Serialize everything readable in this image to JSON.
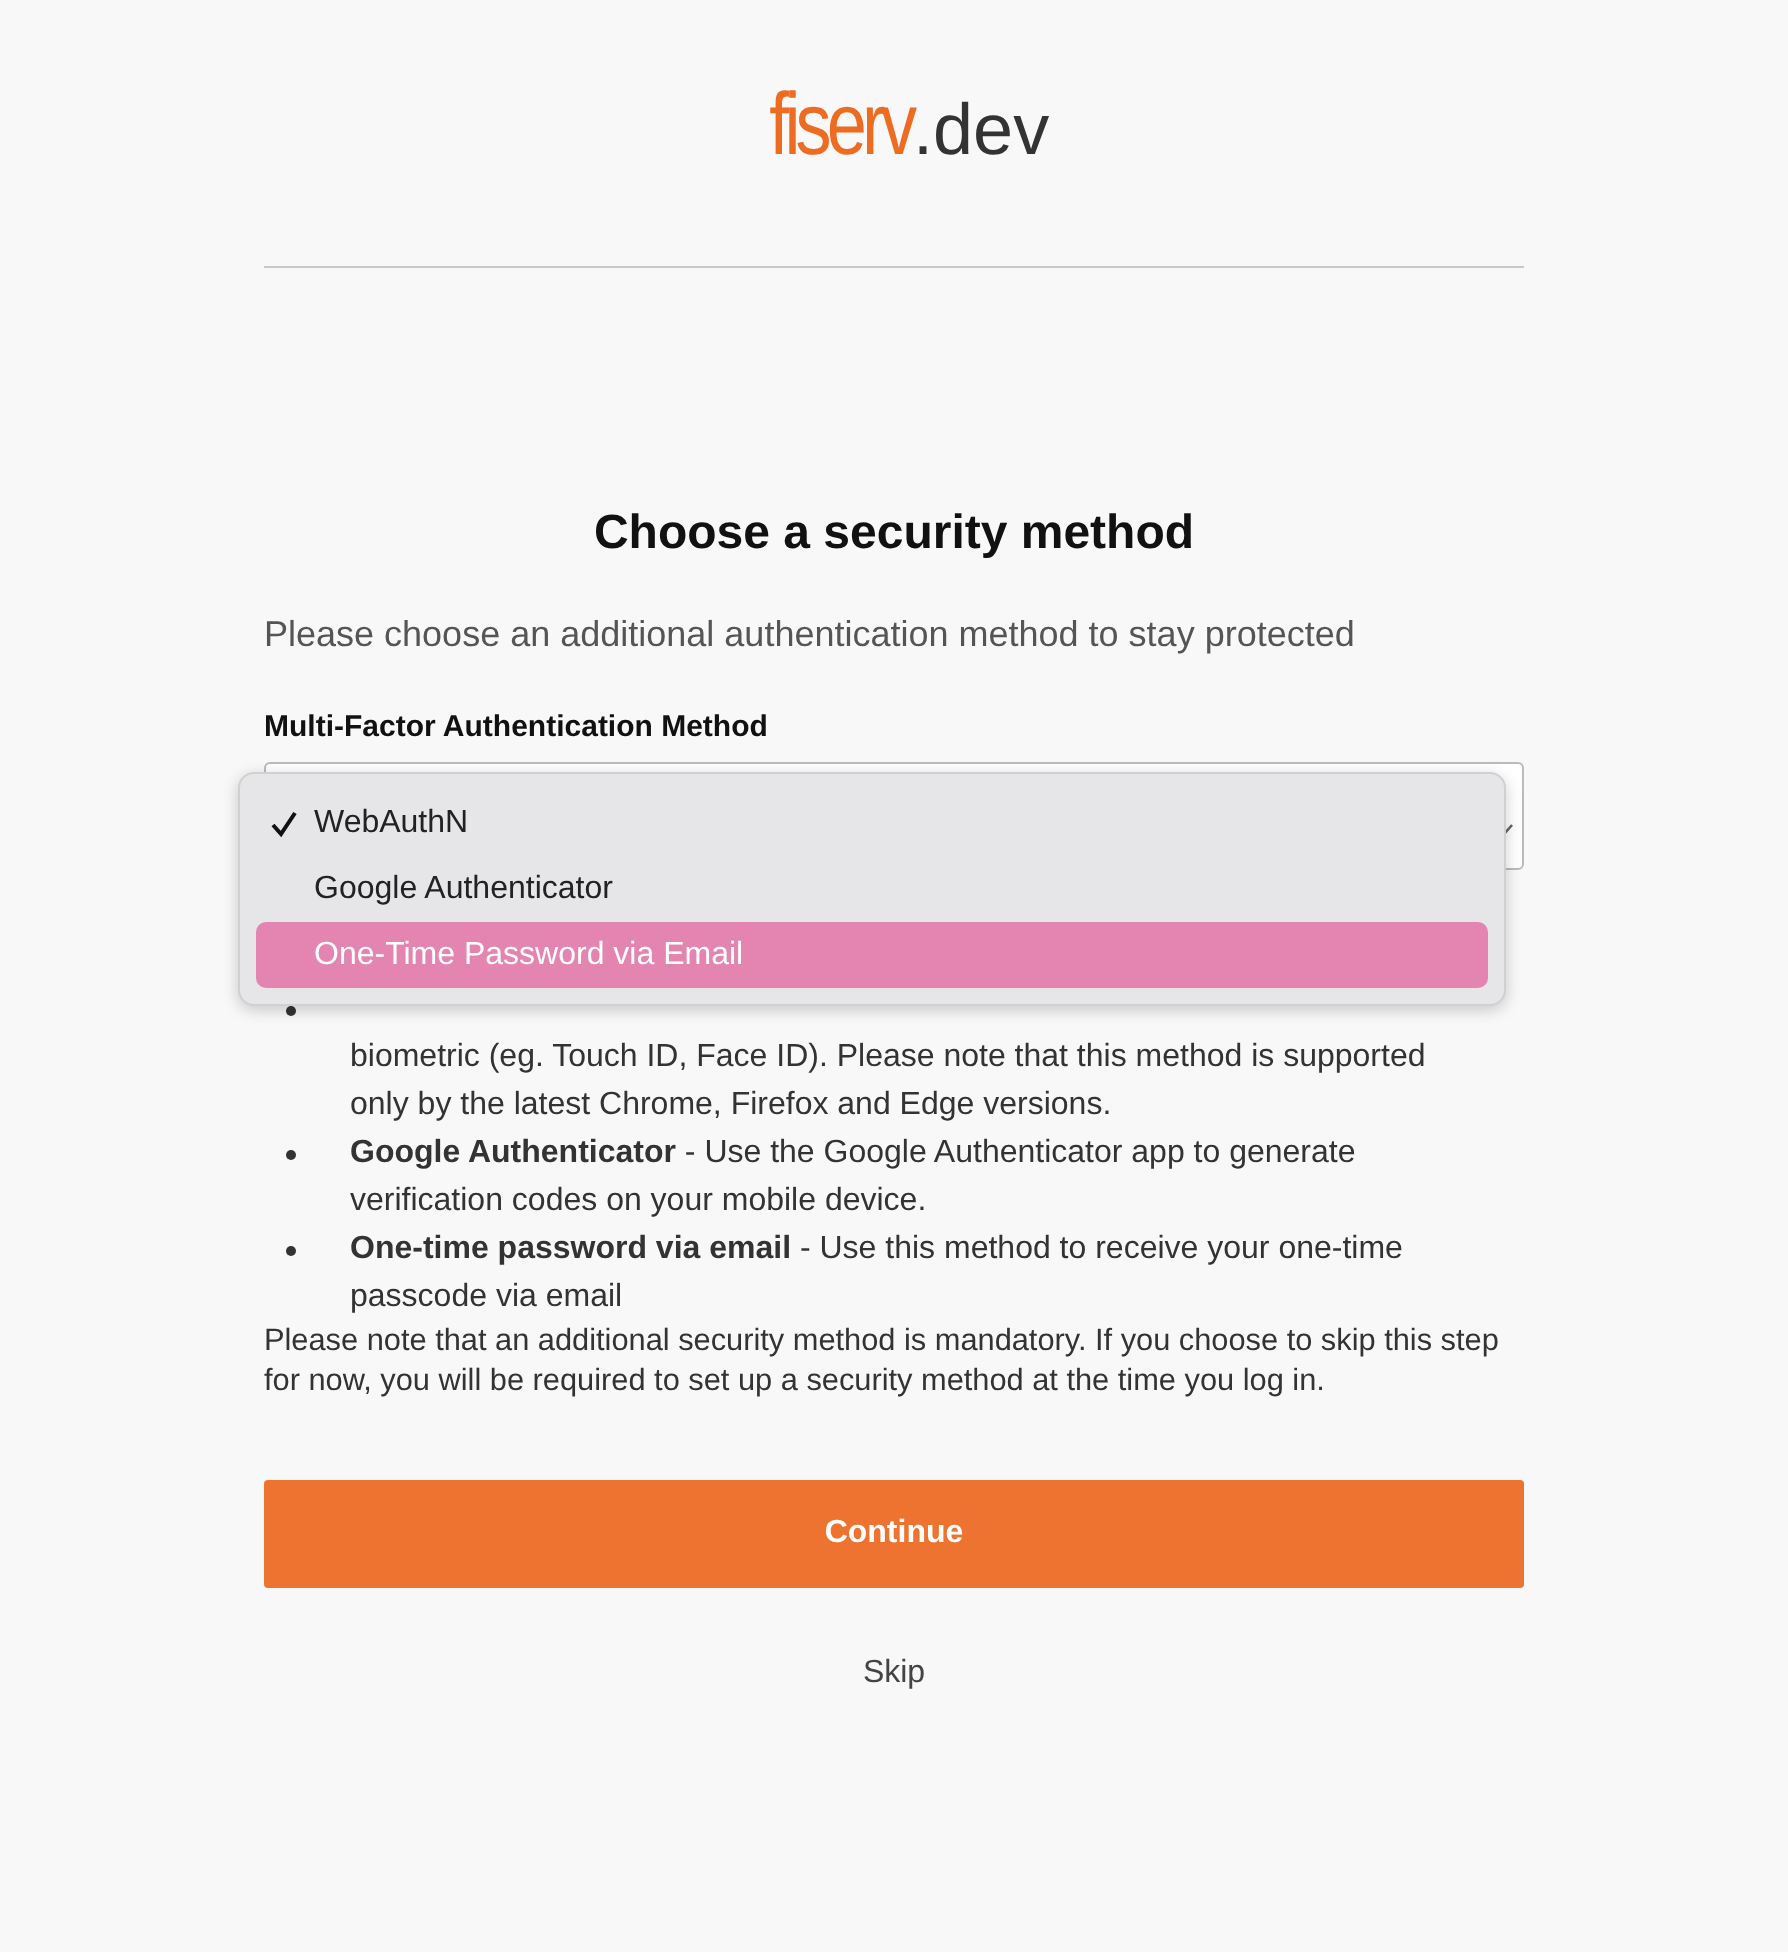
{
  "logo": {
    "brand": "fiserv",
    "suffix": ".dev"
  },
  "heading": "Choose a security method",
  "subtitle": "Please choose an additional authentication method to stay protected",
  "field": {
    "label": "Multi-Factor Authentication Method",
    "expanded": true
  },
  "dropdown": [
    {
      "label": "WebAuthN",
      "checked": true,
      "highlighted": false
    },
    {
      "label": "Google Authenticator",
      "checked": false,
      "highlighted": false
    },
    {
      "label": "One-Time Password via Email",
      "checked": false,
      "highlighted": true
    }
  ],
  "methods": [
    {
      "text": "biometric (eg. Touch ID, Face ID). Please note that this method is supported only by the latest Chrome, Firefox and Edge versions.",
      "first_line_covered": true
    },
    {
      "text": "**Google Authenticator** - Use the Google Authenticator app to generate verification codes on your mobile device."
    },
    {
      "text": "**One-time password via email** - Use this method to receive your one-time passcode via email"
    }
  ],
  "note": "Please note that an additional security method is mandatory. If you choose to skip this step for now, you will be required to set up a security method at the time you log in.",
  "continue_button": "Continue",
  "skip_link": "Skip"
}
